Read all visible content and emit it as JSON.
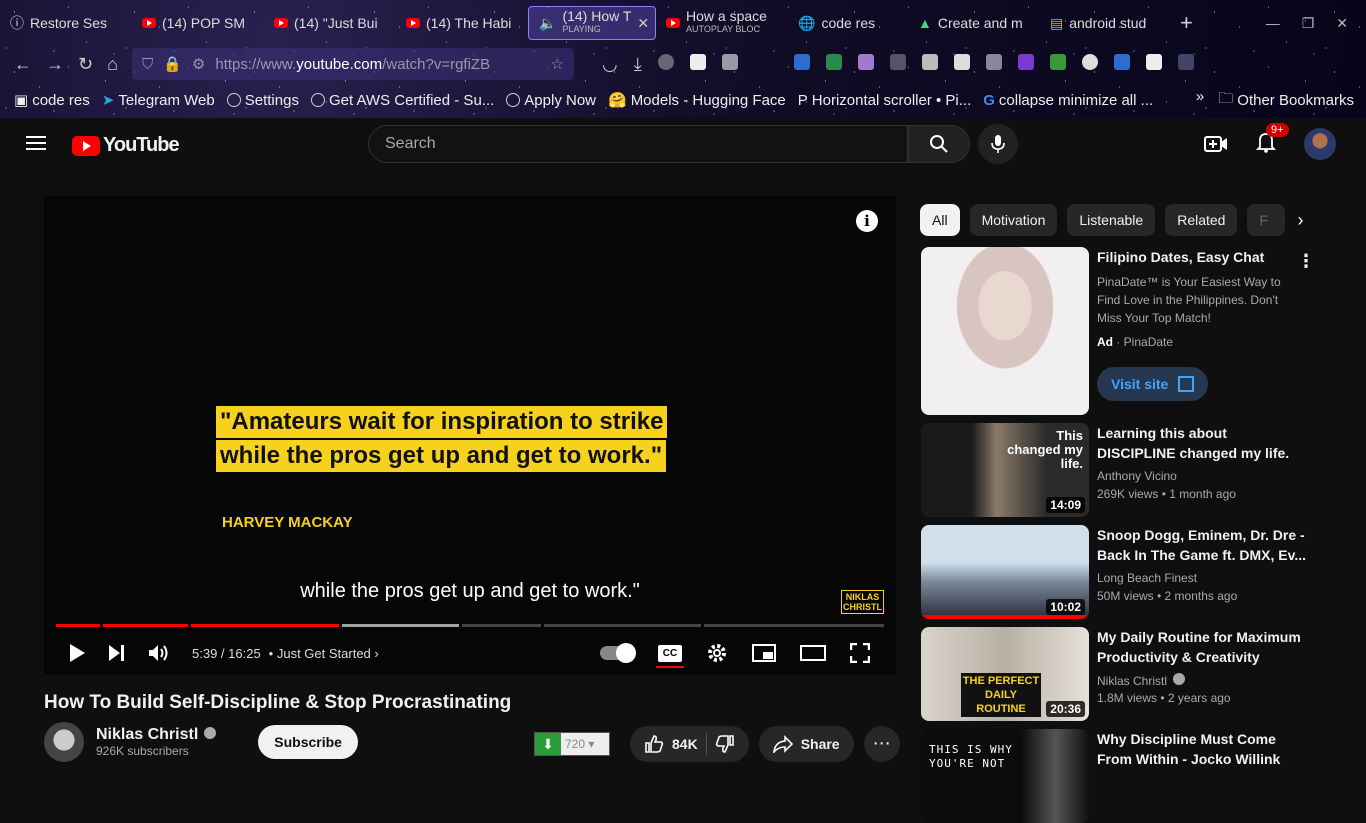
{
  "browser": {
    "tabs": [
      {
        "label": "Restore Ses",
        "sub": ""
      },
      {
        "label": "(14) POP SM",
        "sub": ""
      },
      {
        "label": "(14) \"Just Bui",
        "sub": ""
      },
      {
        "label": "(14) The Habi",
        "sub": ""
      },
      {
        "label": "(14) How T",
        "sub": "PLAYING"
      },
      {
        "label": "How a space",
        "sub": "AUTOPLAY BLOC"
      },
      {
        "label": "code res",
        "sub": ""
      },
      {
        "label": "Create and m",
        "sub": ""
      },
      {
        "label": "android stud",
        "sub": ""
      }
    ],
    "url_prefix": "https://www.",
    "url_host": "youtube.com",
    "url_path": "/watch?v=rgfiZB",
    "bookmarks": [
      "code res",
      "Telegram Web",
      "Settings",
      "Get AWS Certified - Su...",
      "Apply Now",
      "Models - Hugging Face",
      "Horizontal scroller • Pi...",
      "collapse minimize all ..."
    ],
    "bookmarks_more": "»",
    "other_bookmarks": "Other Bookmarks"
  },
  "yt": {
    "logo_text": "YouTube",
    "search_placeholder": "Search",
    "notif_badge": "9+"
  },
  "player": {
    "quote_line1": "\"Amateurs wait for inspiration to strike",
    "quote_line2": "while the pros get up and get to work.\"",
    "author": "HARVEY MACKAY",
    "caption": "while the pros get up and get to work.\"",
    "watermark_line1": "NIKLAS",
    "watermark_line2": "CHRISTL",
    "time": "5:39 / 16:25",
    "chapter": "Just Get Started",
    "played_fraction": 0.343,
    "buffered_fraction": 0.487,
    "cc_label": "CC"
  },
  "video": {
    "title": "How To Build Self-Discipline & Stop Procrastinating",
    "channel": "Niklas Christl",
    "subscribers": "926K subscribers",
    "subscribe_label": "Subscribe",
    "download_quality": "720",
    "likes": "84K",
    "share_label": "Share"
  },
  "chips": [
    "All",
    "Motivation",
    "Listenable",
    "Related",
    "F"
  ],
  "ad": {
    "title": "Filipino Dates, Easy Chat",
    "desc": "PinaDate™ is Your Easiest Way to Find Love in the Philippines. Don't Miss Your Top Match!",
    "ad_label": "Ad",
    "advertiser": "PinaDate",
    "cta": "Visit site"
  },
  "recs": [
    {
      "title": "Learning this about DISCIPLINE changed my life.",
      "channel": "Anthony Vicino",
      "meta": "269K views  •  1 month ago",
      "duration": "14:09",
      "thumb_text": "This changed my life."
    },
    {
      "title": "Snoop Dogg, Eminem, Dr. Dre - Back In The Game ft. DMX, Ev...",
      "channel": "Long Beach Finest",
      "meta": "50M views  •  2 months ago",
      "duration": "10:02",
      "thumb_text": ""
    },
    {
      "title": "My Daily Routine for Maximum Productivity & Creativity",
      "channel": "Niklas Christl",
      "meta": "1.8M views  •  2 years ago",
      "duration": "20:36",
      "thumb_text": "THE PERFECT DAILY ROUTINE"
    },
    {
      "title": "Why Discipline Must Come From Within - Jocko Willink",
      "channel": "",
      "meta": "",
      "duration": "",
      "thumb_text": "THIS IS WHY YOU'RE NOT"
    }
  ]
}
